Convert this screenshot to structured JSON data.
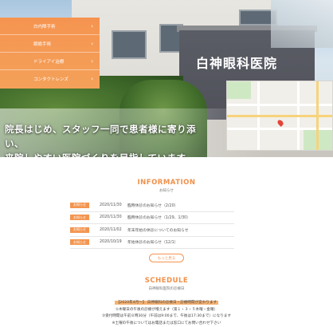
{
  "hero": {
    "sign_text": "白神眼科医院",
    "tagline_line1": "院長はじめ、スタッフ一同で患者様に寄り添い、",
    "tagline_line2": "来院しやすい医院づくりを目指しています。"
  },
  "menu": {
    "items": [
      {
        "label": "白内障手術",
        "arrow": "›"
      },
      {
        "label": "眼瞼手術",
        "arrow": "›"
      },
      {
        "label": "ドライアイ治療",
        "arrow": "›"
      },
      {
        "label": "コンタクトレンズ",
        "arrow": "›"
      }
    ]
  },
  "information": {
    "title": "INFORMATION",
    "subtitle": "お知らせ",
    "items": [
      {
        "badge": "お知らせ",
        "date": "2020/11/30",
        "title": "臨時休診のお知らせ（2/20）"
      },
      {
        "badge": "お知らせ",
        "date": "2020/11/30",
        "title": "臨時休診のお知らせ（1/29、1/30）"
      },
      {
        "badge": "お知らせ",
        "date": "2020/11/02",
        "title": "年末年始の休診についてのお知らせ"
      },
      {
        "badge": "お知らせ",
        "date": "2020/10/19",
        "title": "年始休診のお知らせ（12/1）"
      }
    ],
    "more_label": "もっと見る"
  },
  "schedule": {
    "title": "SCHEDULE",
    "subtitle": "白神眼科医院の診療日",
    "notice_lines": [
      "【2020年4月～】 白神眼科の診療日・診療時間が変わります",
      "①木曜日の午後の診療が増えます（第１・３・５木曜・金曜）",
      "②受付時間は午前８時30分（午前は9:00まで、午後は17:30まで）になります",
      "※土曜の午後についてはお電話または窓口にてお問い合わせ下さい"
    ]
  },
  "colors": {
    "accent": "#f39550",
    "menu_bg": "#f59450",
    "title_orange": "#f0904a"
  }
}
